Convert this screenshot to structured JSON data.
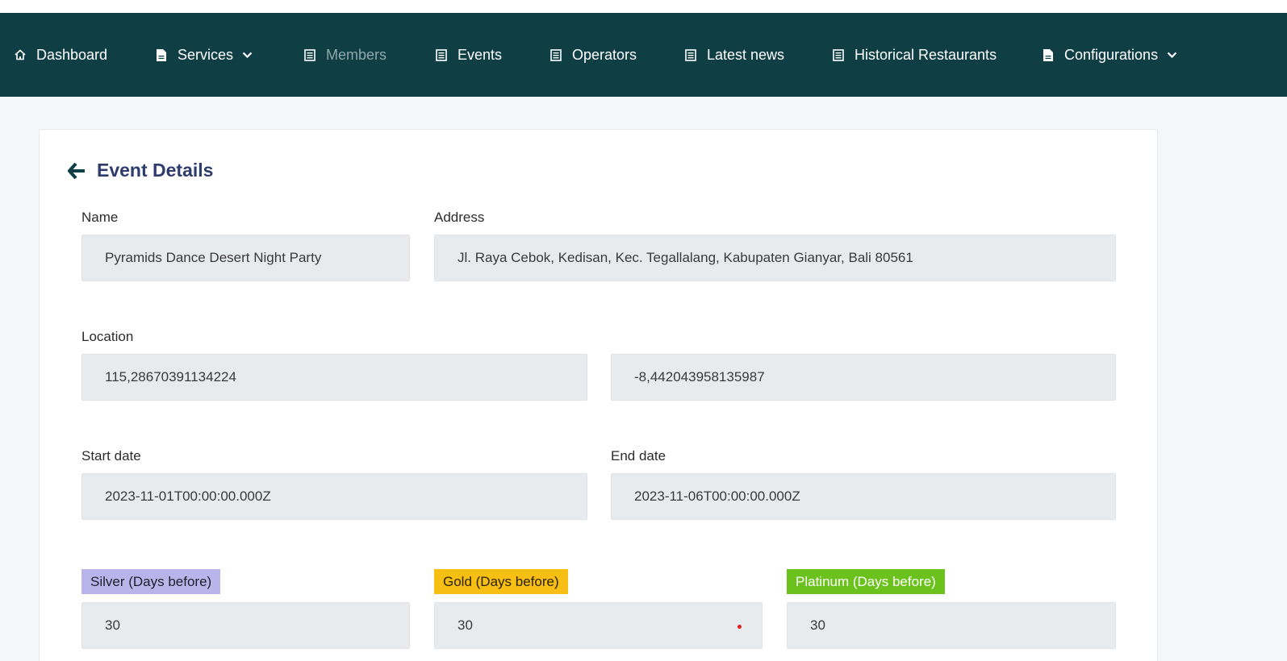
{
  "nav": {
    "items": [
      {
        "label": "Dashboard",
        "icon": "home-icon"
      },
      {
        "label": "Services",
        "icon": "document-icon",
        "dropdown": true
      },
      {
        "label": "Members",
        "icon": "list-icon",
        "active": true
      },
      {
        "label": "Events",
        "icon": "list-icon"
      },
      {
        "label": "Operators",
        "icon": "list-icon"
      },
      {
        "label": "Latest news",
        "icon": "list-icon"
      },
      {
        "label": "Historical Restaurants",
        "icon": "list-icon"
      },
      {
        "label": "Configurations",
        "icon": "document-icon",
        "dropdown": true
      }
    ]
  },
  "page": {
    "title": "Event Details"
  },
  "form": {
    "name_label": "Name",
    "name_value": "Pyramids Dance Desert Night Party",
    "address_label": "Address",
    "address_value": "Jl. Raya Cebok, Kedisan, Kec. Tegallalang, Kabupaten Gianyar, Bali 80561",
    "location_label": "Location",
    "longitude_value": "115,28670391134224",
    "latitude_value": "-8,442043958135987",
    "start_label": "Start date",
    "start_value": "2023-11-01T00:00:00.000Z",
    "end_label": "End date",
    "end_value": "2023-11-06T00:00:00.000Z",
    "silver_label": "Silver (Days before)",
    "silver_value": "30",
    "gold_label": "Gold (Days before)",
    "gold_value": "30",
    "platinum_label": "Platinum (Days before)",
    "platinum_value": "30"
  },
  "colors": {
    "navbar": "#0f3f45",
    "title": "#2e3c6d",
    "silver": "#b9b5ea",
    "gold": "#f7bf14",
    "platinum": "#6cc21c"
  }
}
